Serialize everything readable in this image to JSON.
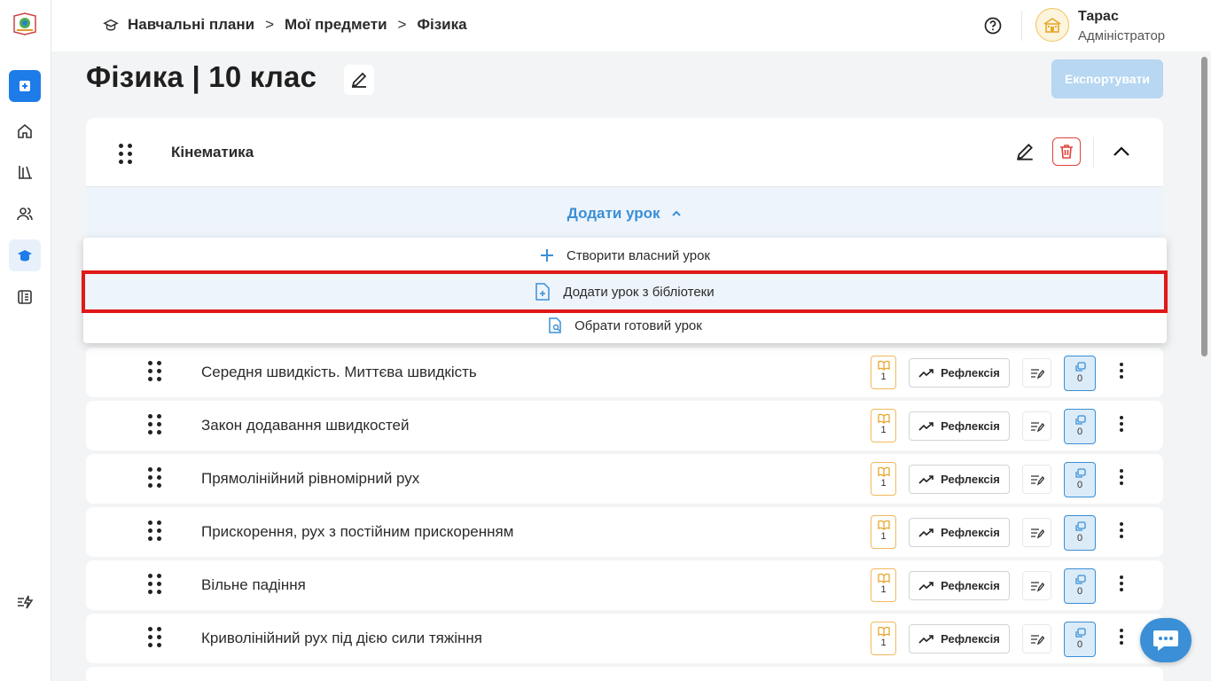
{
  "breadcrumb": {
    "items": [
      "Навчальні плани",
      "Мої предмети",
      "Фізика"
    ],
    "separator": ">"
  },
  "user": {
    "name": "Тарас",
    "role": "Адміністратор"
  },
  "page": {
    "title": "Фізика | 10 клас",
    "export_label": "Експортувати"
  },
  "section": {
    "name": "Кінематика",
    "add_lesson_label": "Додати урок"
  },
  "dropdown": {
    "create": "Створити власний урок",
    "library": "Додати урок з бібліотеки",
    "choose": "Обрати готовий урок"
  },
  "lessons": [
    {
      "title": "Середня швидкість. Миттєва швидкість",
      "books": "1",
      "copies": "0",
      "reflection": "Рефлексія"
    },
    {
      "title": "Закон додавання швидкостей",
      "books": "1",
      "copies": "0",
      "reflection": "Рефлексія"
    },
    {
      "title": "Прямолінійний рівномірний рух",
      "books": "1",
      "copies": "0",
      "reflection": "Рефлексія"
    },
    {
      "title": "Прискорення, рух з постійним прискоренням",
      "books": "1",
      "copies": "0",
      "reflection": "Рефлексія"
    },
    {
      "title": "Вільне падіння",
      "books": "1",
      "copies": "0",
      "reflection": "Рефлексія"
    },
    {
      "title": "Криволінійний рух під дією сили тяжіння",
      "books": "1",
      "copies": "0",
      "reflection": "Рефлексія"
    }
  ],
  "colors": {
    "accent": "#3a8fd6",
    "highlight": "#e01818",
    "badge_orange": "#f1b95b"
  }
}
